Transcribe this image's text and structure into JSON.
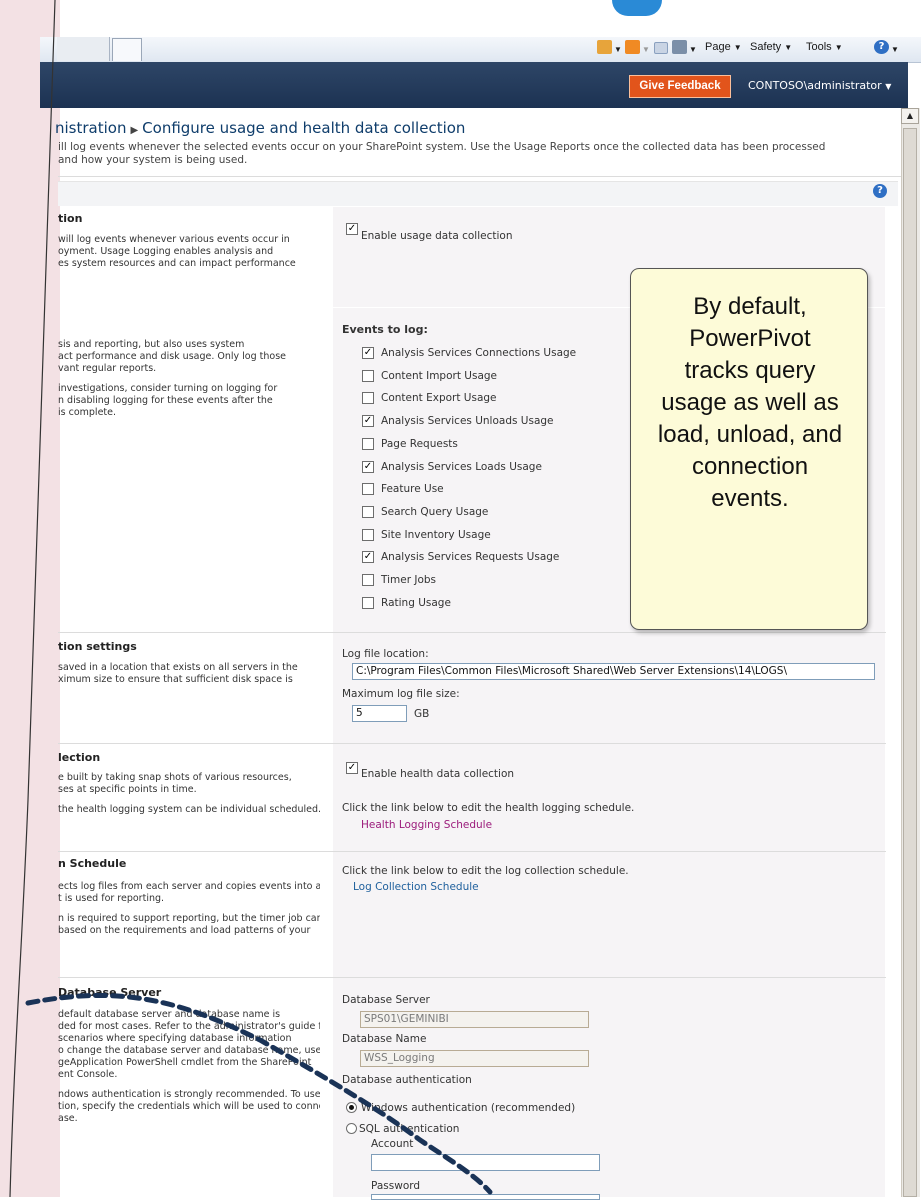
{
  "browser": {
    "page_label": "Page",
    "safety_label": "Safety",
    "tools_label": "Tools"
  },
  "ribbon": {
    "feedback_label": "Give Feedback",
    "user_label": "CONTOSO\\administrator"
  },
  "page": {
    "breadcrumb_root": "nistration",
    "breadcrumb_current": "Configure usage and health data collection",
    "desc_line1": "ill log events whenever the selected events occur on your SharePoint system. Use the Usage Reports once the collected data has been processed",
    "desc_line2": "and how your system is being used."
  },
  "sections": {
    "usage": {
      "title": "tion",
      "desc": [
        "will log events whenever various events occur in",
        "oyment. Usage Logging enables analysis and",
        "es system resources and can impact performance"
      ],
      "checkbox_label": "Enable usage data collection",
      "checked": true
    },
    "events": {
      "desc": [
        "sis and reporting, but also uses system",
        "act performance and disk usage. Only log those",
        "vant regular reports.",
        "",
        "investigations, consider turning on logging for",
        "n disabling logging for these events after the",
        "is complete."
      ],
      "heading": "Events to log:",
      "items": [
        {
          "label": "Analysis Services Connections Usage",
          "checked": true
        },
        {
          "label": "Content Import Usage",
          "checked": false
        },
        {
          "label": "Content Export Usage",
          "checked": false
        },
        {
          "label": "Analysis Services Unloads Usage",
          "checked": true
        },
        {
          "label": "Page Requests",
          "checked": false
        },
        {
          "label": "Analysis Services Loads Usage",
          "checked": true
        },
        {
          "label": "Feature Use",
          "checked": false
        },
        {
          "label": "Search Query Usage",
          "checked": false
        },
        {
          "label": "Site Inventory Usage",
          "checked": false
        },
        {
          "label": "Analysis Services Requests Usage",
          "checked": true
        },
        {
          "label": "Timer Jobs",
          "checked": false
        },
        {
          "label": "Rating Usage",
          "checked": false
        }
      ]
    },
    "log_settings": {
      "title": "tion settings",
      "desc": [
        "saved in a location that exists on all servers in the",
        "ximum size to ensure that sufficient disk space is"
      ],
      "location_label": "Log file location:",
      "location_value": "C:\\Program Files\\Common Files\\Microsoft Shared\\Web Server Extensions\\14\\LOGS\\",
      "max_size_label": "Maximum log file size:",
      "max_size_value": "5",
      "max_size_unit": "GB"
    },
    "health": {
      "title": "lection",
      "desc": [
        "e built by taking snap shots of various resources,",
        "ses at specific points in time.",
        "",
        "the health logging system can be individual scheduled."
      ],
      "checkbox_label": "Enable health data collection",
      "checked": true,
      "hint": "Click the link below to edit the health logging schedule.",
      "link": "Health Logging Schedule"
    },
    "schedule": {
      "title": "n Schedule",
      "desc": [
        "ects log files from each server and copies events into a",
        "t is used for reporting.",
        "",
        "n is required to support reporting, but the timer job can be",
        "based on the requirements and load patterns of your"
      ],
      "hint": "Click the link below to edit the log collection schedule.",
      "link": "Log Collection Schedule"
    },
    "database": {
      "title": "Database Server",
      "desc": [
        "default database server and database name is",
        "ded for most cases. Refer to the administrator's guide for",
        "scenarios where specifying database information",
        "o change the database server and database name, use the",
        "geApplication PowerShell cmdlet from the SharePoint",
        "ent Console.",
        "",
        "ndows authentication is strongly recommended. To use SQL",
        "tion, specify the credentials which will be used to connect to",
        "ase."
      ],
      "server_label": "Database Server",
      "server_value": "SPS01\\GEMINIBI",
      "name_label": "Database Name",
      "name_value": "WSS_Logging",
      "auth_label": "Database authentication",
      "auth_windows": "Windows authentication (recommended)",
      "auth_sql": "SQL authentication",
      "account_label": "Account",
      "password_label": "Password"
    }
  },
  "callout": {
    "text": "By default, PowerPivot tracks query usage as well as load, unload, and connection events."
  },
  "colors": {
    "ribbon": "#1c3252",
    "feedback": "#e2541b",
    "callout_bg": "#fdfbd8",
    "left_panel": "#f3e1e4"
  }
}
